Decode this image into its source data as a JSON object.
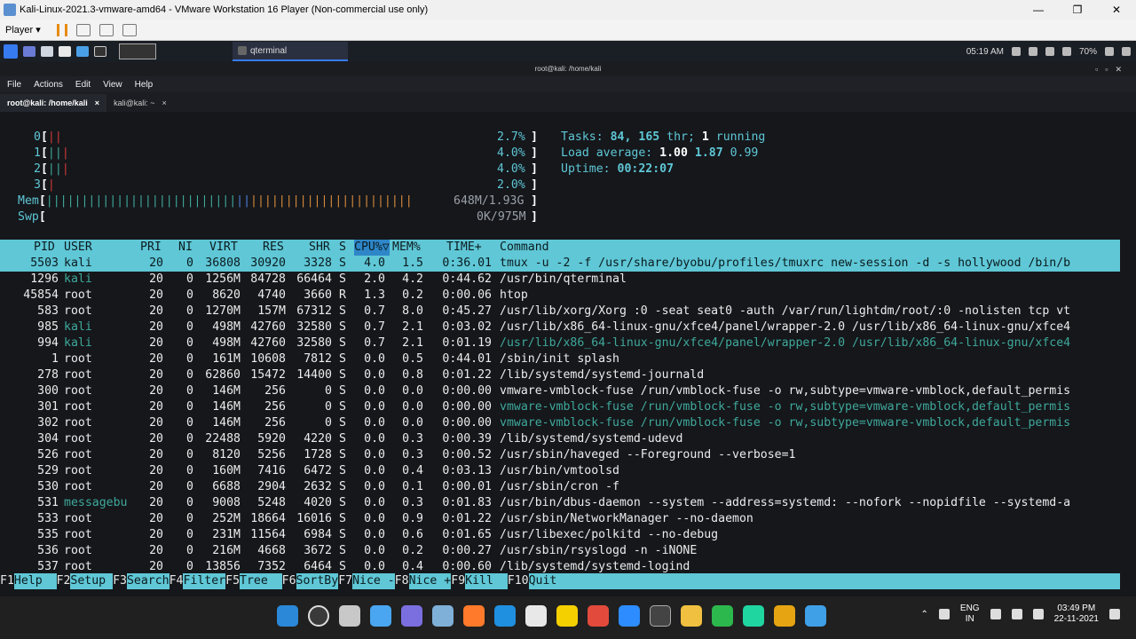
{
  "vmware": {
    "title": "Kali-Linux-2021.3-vmware-amd64 - VMware Workstation 16 Player (Non-commercial use only)",
    "player_menu": "Player ▾",
    "minimize": "—",
    "restore": "❐",
    "close": "✕"
  },
  "kali_panel": {
    "task_label": "qterminal",
    "time": "05:19 AM",
    "battery": "70%"
  },
  "terminal": {
    "window_title": "root@kali: /home/kali",
    "menu": [
      "File",
      "Actions",
      "Edit",
      "View",
      "Help"
    ],
    "tabs": [
      {
        "label": "root@kali: /home/kali",
        "close": "×"
      },
      {
        "label": "kali@kali: ~",
        "close": "×"
      }
    ]
  },
  "htop": {
    "meters": {
      "cpu": [
        {
          "id": "0",
          "percent": "2.7%"
        },
        {
          "id": "1",
          "percent": "4.0%"
        },
        {
          "id": "2",
          "percent": "4.0%"
        },
        {
          "id": "3",
          "percent": "2.0%"
        }
      ],
      "mem": {
        "label": "Mem",
        "value": "648M/1.93G"
      },
      "swp": {
        "label": "Swp",
        "value": "0K/975M"
      }
    },
    "summary": {
      "tasks_label": "Tasks:",
      "tasks": "84,",
      "threads": "165",
      "thr_label": "thr;",
      "running": "1",
      "running_label": "running",
      "load_label": "Load average:",
      "load1": "1.00",
      "load5": "1.87",
      "load15": "0.99",
      "uptime_label": "Uptime:",
      "uptime": "00:22:07"
    },
    "columns": {
      "pid": "PID",
      "user": "USER",
      "pri": "PRI",
      "ni": "NI",
      "virt": "VIRT",
      "res": "RES",
      "shr": "SHR",
      "s": "S",
      "cpu": "CPU%▽",
      "mem": "MEM%",
      "time": "TIME+",
      "command": "Command"
    },
    "processes": [
      {
        "pid": "5503",
        "user": "kali",
        "pri": "20",
        "ni": "0",
        "virt": "36808",
        "res": "30920",
        "shr": "3328",
        "s": "S",
        "cpu": "4.0",
        "mem": "1.5",
        "time": "0:36.01",
        "command": "tmux -u -2 -f /usr/share/byobu/profiles/tmuxrc new-session -d -s hollywood /bin/b"
      },
      {
        "pid": "1296",
        "user": "kali",
        "pri": "20",
        "ni": "0",
        "virt": "1256M",
        "res": "84728",
        "shr": "66464",
        "s": "S",
        "cpu": "2.0",
        "mem": "4.2",
        "time": "0:44.62",
        "command": "/usr/bin/qterminal"
      },
      {
        "pid": "45854",
        "user": "root",
        "pri": "20",
        "ni": "0",
        "virt": "8620",
        "res": "4740",
        "shr": "3660",
        "s": "R",
        "cpu": "1.3",
        "mem": "0.2",
        "time": "0:00.06",
        "command": "htop"
      },
      {
        "pid": "583",
        "user": "root",
        "pri": "20",
        "ni": "0",
        "virt": "1270M",
        "res": "157M",
        "shr": "67312",
        "s": "S",
        "cpu": "0.7",
        "mem": "8.0",
        "time": "0:45.27",
        "command": "/usr/lib/xorg/Xorg :0 -seat seat0 -auth /var/run/lightdm/root/:0 -nolisten tcp vt"
      },
      {
        "pid": "985",
        "user": "kali",
        "pri": "20",
        "ni": "0",
        "virt": "498M",
        "res": "42760",
        "shr": "32580",
        "s": "S",
        "cpu": "0.7",
        "mem": "2.1",
        "time": "0:03.02",
        "command": "/usr/lib/x86_64-linux-gnu/xfce4/panel/wrapper-2.0 /usr/lib/x86_64-linux-gnu/xfce4"
      },
      {
        "pid": "994",
        "user": "kali",
        "pri": "20",
        "ni": "0",
        "virt": "498M",
        "res": "42760",
        "shr": "32580",
        "s": "S",
        "cpu": "0.7",
        "mem": "2.1",
        "time": "0:01.19",
        "command": "/usr/lib/x86_64-linux-gnu/xfce4/panel/wrapper-2.0 /usr/lib/x86_64-linux-gnu/xfce4",
        "thread": true
      },
      {
        "pid": "1",
        "user": "root",
        "pri": "20",
        "ni": "0",
        "virt": "161M",
        "res": "10608",
        "shr": "7812",
        "s": "S",
        "cpu": "0.0",
        "mem": "0.5",
        "time": "0:44.01",
        "command": "/sbin/init splash"
      },
      {
        "pid": "278",
        "user": "root",
        "pri": "20",
        "ni": "0",
        "virt": "62860",
        "res": "15472",
        "shr": "14400",
        "s": "S",
        "cpu": "0.0",
        "mem": "0.8",
        "time": "0:01.22",
        "command": "/lib/systemd/systemd-journald"
      },
      {
        "pid": "300",
        "user": "root",
        "pri": "20",
        "ni": "0",
        "virt": "146M",
        "res": "256",
        "shr": "0",
        "s": "S",
        "cpu": "0.0",
        "mem": "0.0",
        "time": "0:00.00",
        "command": "vmware-vmblock-fuse /run/vmblock-fuse -o rw,subtype=vmware-vmblock,default_permis"
      },
      {
        "pid": "301",
        "user": "root",
        "pri": "20",
        "ni": "0",
        "virt": "146M",
        "res": "256",
        "shr": "0",
        "s": "S",
        "cpu": "0.0",
        "mem": "0.0",
        "time": "0:00.00",
        "command": "vmware-vmblock-fuse /run/vmblock-fuse -o rw,subtype=vmware-vmblock,default_permis",
        "thread": true
      },
      {
        "pid": "302",
        "user": "root",
        "pri": "20",
        "ni": "0",
        "virt": "146M",
        "res": "256",
        "shr": "0",
        "s": "S",
        "cpu": "0.0",
        "mem": "0.0",
        "time": "0:00.00",
        "command": "vmware-vmblock-fuse /run/vmblock-fuse -o rw,subtype=vmware-vmblock,default_permis",
        "thread": true
      },
      {
        "pid": "304",
        "user": "root",
        "pri": "20",
        "ni": "0",
        "virt": "22488",
        "res": "5920",
        "shr": "4220",
        "s": "S",
        "cpu": "0.0",
        "mem": "0.3",
        "time": "0:00.39",
        "command": "/lib/systemd/systemd-udevd"
      },
      {
        "pid": "526",
        "user": "root",
        "pri": "20",
        "ni": "0",
        "virt": "8120",
        "res": "5256",
        "shr": "1728",
        "s": "S",
        "cpu": "0.0",
        "mem": "0.3",
        "time": "0:00.52",
        "command": "/usr/sbin/haveged --Foreground --verbose=1"
      },
      {
        "pid": "529",
        "user": "root",
        "pri": "20",
        "ni": "0",
        "virt": "160M",
        "res": "7416",
        "shr": "6472",
        "s": "S",
        "cpu": "0.0",
        "mem": "0.4",
        "time": "0:03.13",
        "command": "/usr/bin/vmtoolsd"
      },
      {
        "pid": "530",
        "user": "root",
        "pri": "20",
        "ni": "0",
        "virt": "6688",
        "res": "2904",
        "shr": "2632",
        "s": "S",
        "cpu": "0.0",
        "mem": "0.1",
        "time": "0:00.01",
        "command": "/usr/sbin/cron -f"
      },
      {
        "pid": "531",
        "user": "messagebu",
        "pri": "20",
        "ni": "0",
        "virt": "9008",
        "res": "5248",
        "shr": "4020",
        "s": "S",
        "cpu": "0.0",
        "mem": "0.3",
        "time": "0:01.83",
        "command": "/usr/bin/dbus-daemon --system --address=systemd: --nofork --nopidfile --systemd-a"
      },
      {
        "pid": "533",
        "user": "root",
        "pri": "20",
        "ni": "0",
        "virt": "252M",
        "res": "18664",
        "shr": "16016",
        "s": "S",
        "cpu": "0.0",
        "mem": "0.9",
        "time": "0:01.22",
        "command": "/usr/sbin/NetworkManager --no-daemon"
      },
      {
        "pid": "535",
        "user": "root",
        "pri": "20",
        "ni": "0",
        "virt": "231M",
        "res": "11564",
        "shr": "6984",
        "s": "S",
        "cpu": "0.0",
        "mem": "0.6",
        "time": "0:01.65",
        "command": "/usr/libexec/polkitd --no-debug"
      },
      {
        "pid": "536",
        "user": "root",
        "pri": "20",
        "ni": "0",
        "virt": "216M",
        "res": "4668",
        "shr": "3672",
        "s": "S",
        "cpu": "0.0",
        "mem": "0.2",
        "time": "0:00.27",
        "command": "/usr/sbin/rsyslogd -n -iNONE"
      },
      {
        "pid": "537",
        "user": "root",
        "pri": "20",
        "ni": "0",
        "virt": "13856",
        "res": "7352",
        "shr": "6464",
        "s": "S",
        "cpu": "0.0",
        "mem": "0.4",
        "time": "0:00.60",
        "command": "/lib/systemd/systemd-logind"
      }
    ],
    "fkeys": [
      {
        "key": "F1",
        "label": "Help  "
      },
      {
        "key": "F2",
        "label": "Setup "
      },
      {
        "key": "F3",
        "label": "Search"
      },
      {
        "key": "F4",
        "label": "Filter"
      },
      {
        "key": "F5",
        "label": "Tree  "
      },
      {
        "key": "F6",
        "label": "SortBy"
      },
      {
        "key": "F7",
        "label": "Nice -"
      },
      {
        "key": "F8",
        "label": "Nice +"
      },
      {
        "key": "F9",
        "label": "Kill  "
      },
      {
        "key": "F10",
        "label": "Quit"
      }
    ]
  },
  "windows": {
    "lang_top": "ENG",
    "lang_bottom": "IN",
    "time": "03:49 PM",
    "date": "22-11-2021"
  },
  "colors": {
    "accent": "#5fc7d6",
    "sort_column": "#2e86c8",
    "cpu_low": "#d23a3a",
    "mem_used": "#3fa89a",
    "mem_buffers": "#4e7fd6",
    "mem_cache": "#d88a3a"
  }
}
